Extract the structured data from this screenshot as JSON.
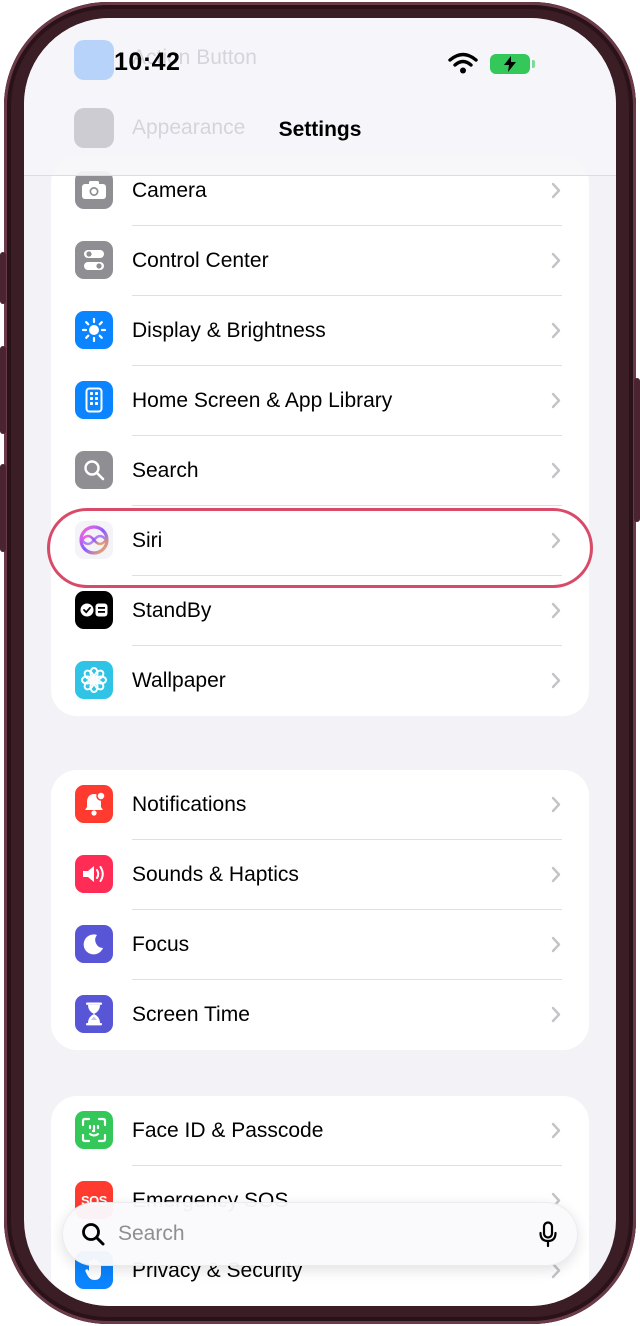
{
  "status_bar": {
    "time": "10:42"
  },
  "nav": {
    "title": "Settings",
    "ghost_items": [
      "Action Button",
      "Appearance"
    ]
  },
  "groups": [
    {
      "items": [
        {
          "label": "Camera",
          "icon": "camera-icon",
          "color": "#8e8e93"
        },
        {
          "label": "Control Center",
          "icon": "toggles-icon",
          "color": "#8e8e93"
        },
        {
          "label": "Display & Brightness",
          "icon": "sun-icon",
          "color": "#0a84ff"
        },
        {
          "label": "Home Screen & App Library",
          "icon": "phone-grid-icon",
          "color": "#0a84ff"
        },
        {
          "label": "Search",
          "icon": "magnifier-icon",
          "color": "#8e8e93"
        },
        {
          "label": "Siri",
          "icon": "siri-icon",
          "color": "#f4f4f8"
        },
        {
          "label": "StandBy",
          "icon": "standby-icon",
          "color": "#000000"
        },
        {
          "label": "Wallpaper",
          "icon": "flower-icon",
          "color": "#2fc4e6"
        }
      ]
    },
    {
      "items": [
        {
          "label": "Notifications",
          "icon": "bell-icon",
          "color": "#ff3b30"
        },
        {
          "label": "Sounds & Haptics",
          "icon": "speaker-icon",
          "color": "#ff2d55"
        },
        {
          "label": "Focus",
          "icon": "moon-icon",
          "color": "#5856d6"
        },
        {
          "label": "Screen Time",
          "icon": "hourglass-icon",
          "color": "#5856d6"
        }
      ]
    },
    {
      "items": [
        {
          "label": "Face ID & Passcode",
          "icon": "faceid-icon",
          "color": "#34c759"
        },
        {
          "label": "Emergency SOS",
          "icon": "sos-icon",
          "color": "#ff3b30"
        },
        {
          "label": "Privacy & Security",
          "icon": "hand-icon",
          "color": "#0a84ff"
        }
      ]
    }
  ],
  "search": {
    "placeholder": "Search"
  },
  "accent": {
    "highlight": "#d84a68"
  }
}
